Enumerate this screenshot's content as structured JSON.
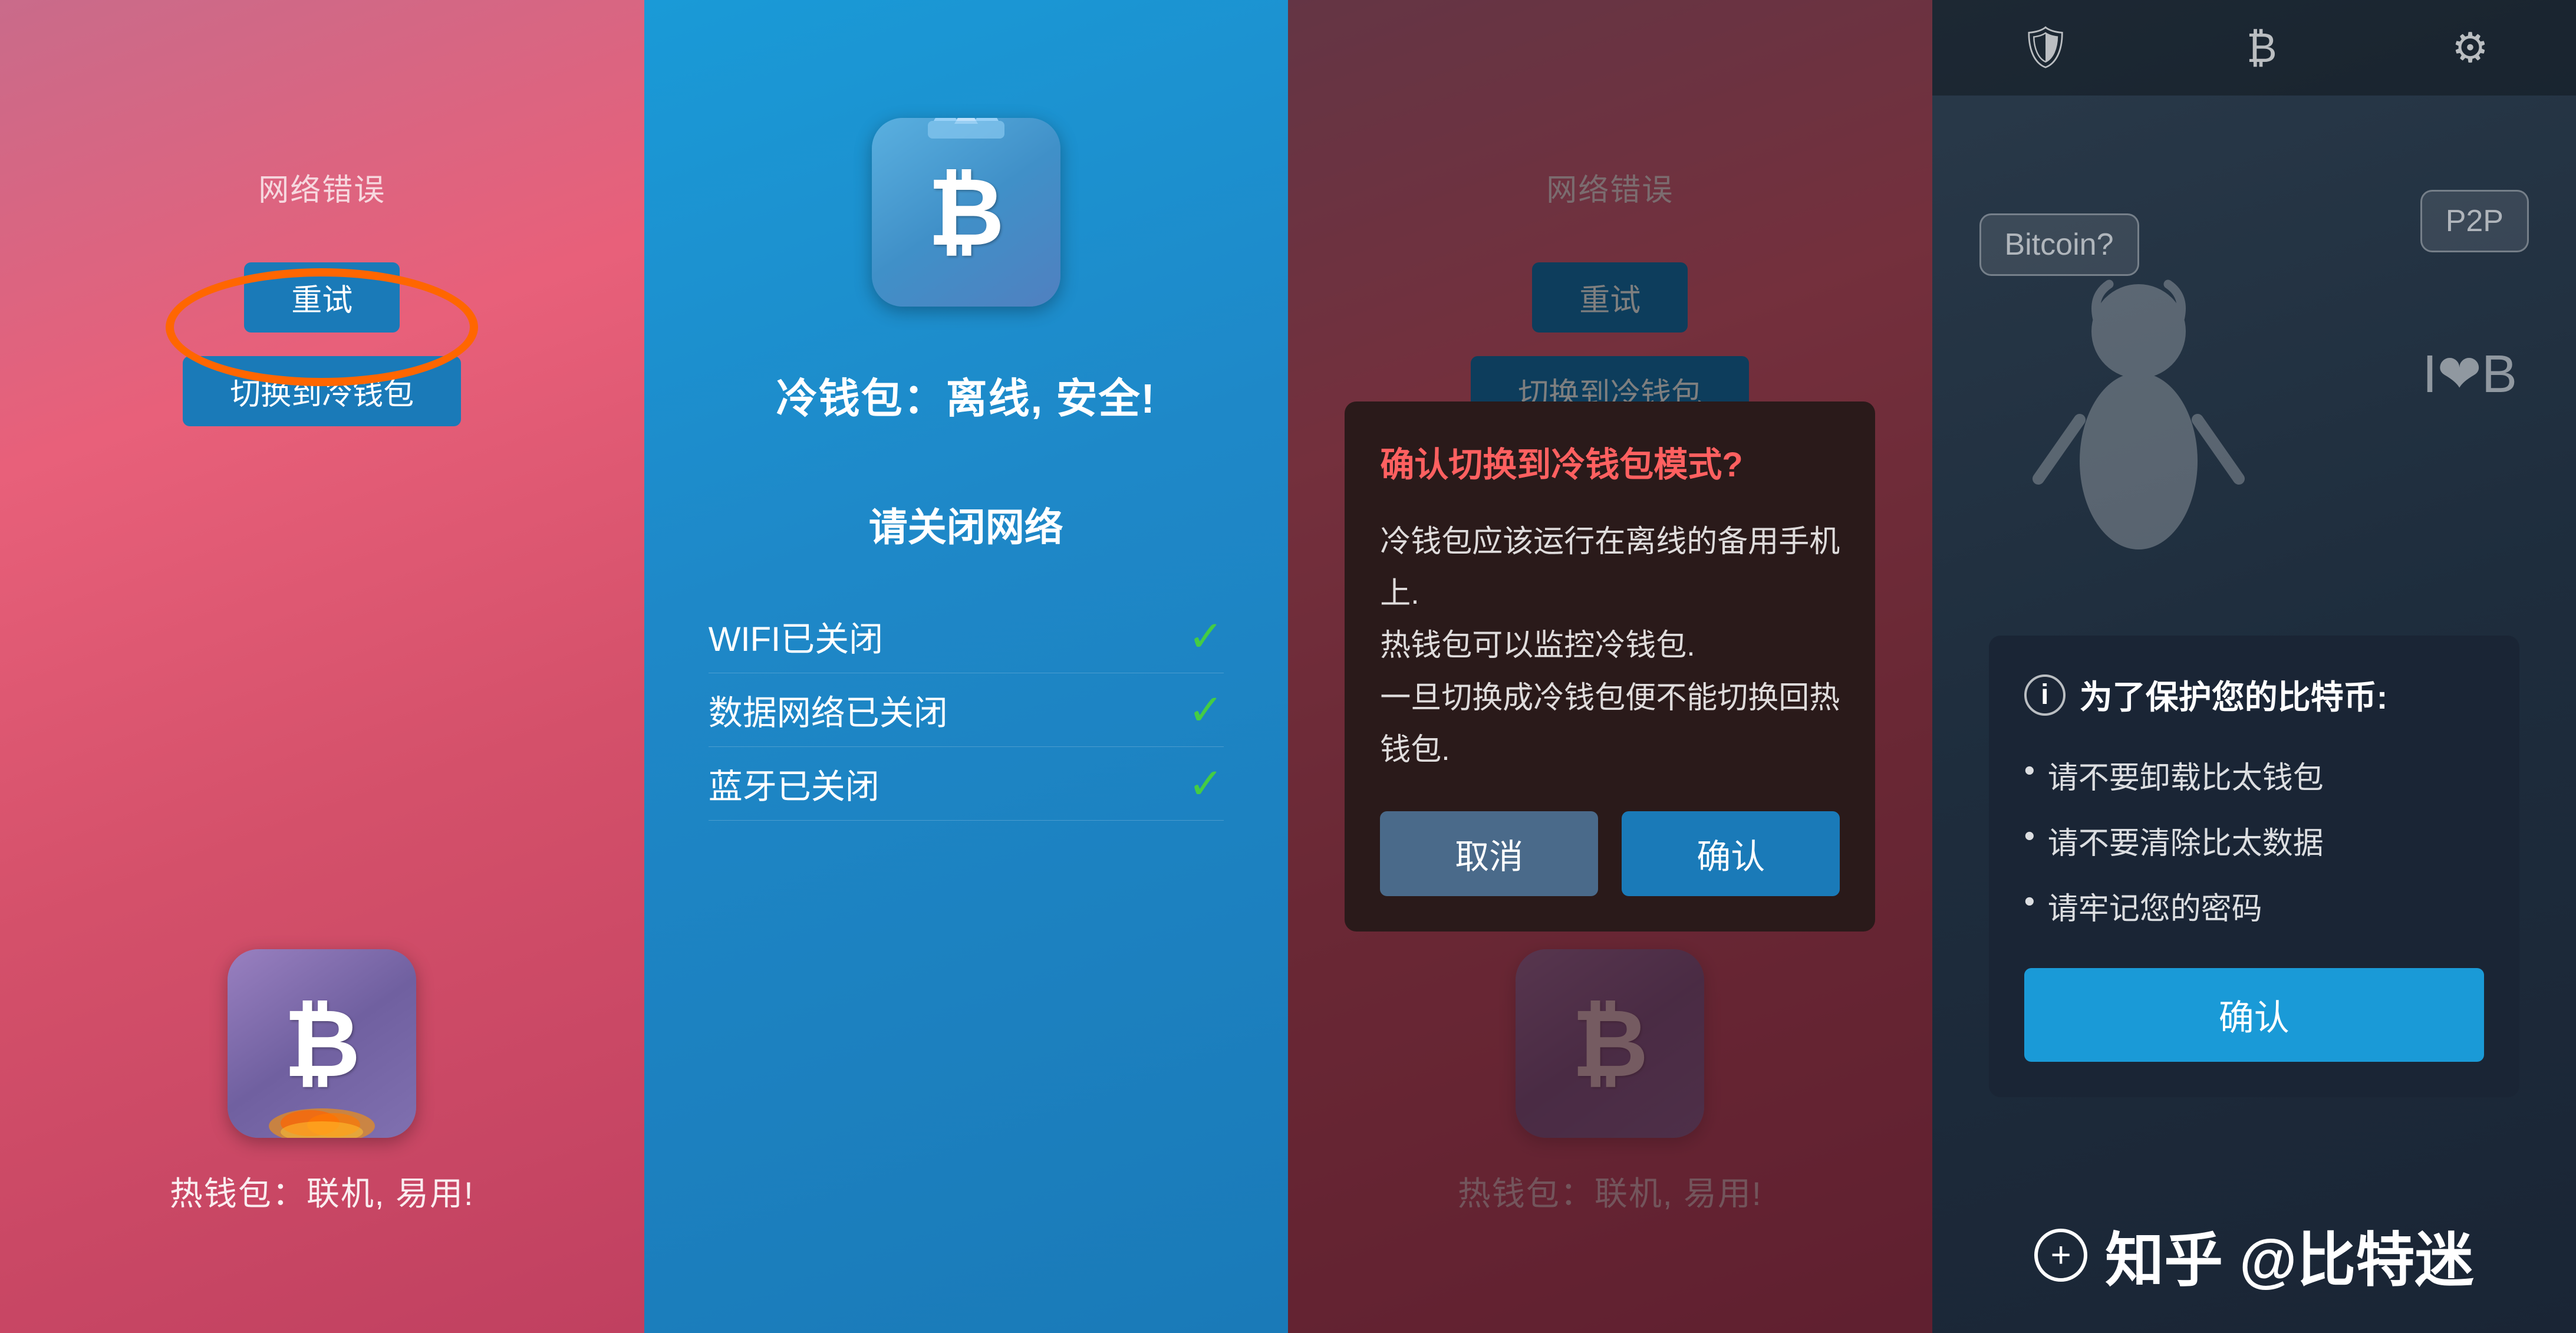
{
  "panel1": {
    "networkError": "网络错误",
    "retryBtn": "重试",
    "switchBtn": "切换到冷钱包",
    "hotWalletLabel": "热钱包：联机, 易用!"
  },
  "panel2": {
    "coldWalletTitle": "冷钱包：离线, 安全!",
    "networkSectionTitle": "请关闭网络",
    "wifiLabel": "WIFI已关闭",
    "dataLabel": "数据网络已关闭",
    "bluetoothLabel": "蓝牙已关闭"
  },
  "panel3": {
    "networkError": "网络错误",
    "retryBtn": "重试",
    "switchBtn": "切换到冷钱包",
    "hotWalletLabel": "热钱包：联机, 易用!",
    "dialogTitle": "确认切换到冷钱包模式?",
    "dialogBody": "冷钱包应该运行在离线的备用手机上.\n热钱包可以监控冷钱包.\n一旦切换成冷钱包便不能切换回热钱包.",
    "cancelBtn": "取消",
    "confirmBtn": "确认"
  },
  "panel4": {
    "infoTitle": "为了保护您的比特币:",
    "infoItem1": "请不要卸载比太钱包",
    "infoItem2": "请不要清除比太数据",
    "infoItem3": "请牢记您的密码",
    "confirmBtn": "确认",
    "watermark": "知乎 @比特迷",
    "bubbleBitcoin": "Bitcoin?",
    "bubbleP2P": "P2P",
    "loveBtc": "I❤B"
  },
  "icons": {
    "shield": "🛡",
    "bitcoin": "₿",
    "gear": "⚙",
    "info": "i",
    "plus": "+"
  }
}
